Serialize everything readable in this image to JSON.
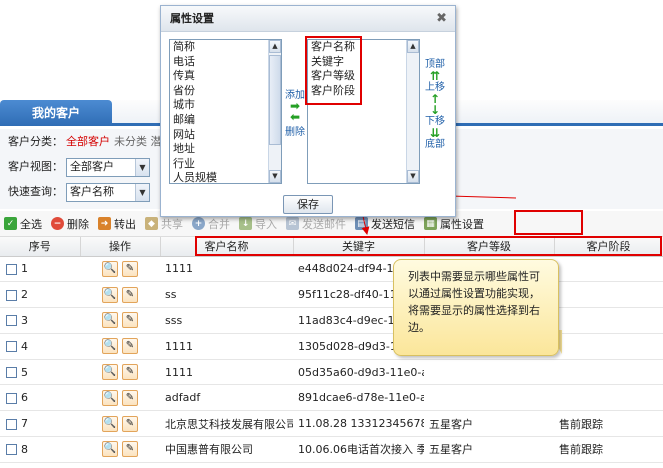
{
  "tab": {
    "label": "我的客户"
  },
  "filters": {
    "category_label": "客户分类：",
    "category_active": "全部客户",
    "category_rest": "未分类 潜",
    "view_label": "客户视图：",
    "view_value": "全部客户",
    "query_label": "快速查询：",
    "query_value": "客户名称"
  },
  "toolbar": {
    "select_all": "全选",
    "delete": "删除",
    "transfer": "转出",
    "share": "共享",
    "merge": "合并",
    "import": "导入",
    "send_mail": "发送邮件",
    "send_sms": "发送短信",
    "attr_settings": "属性设置"
  },
  "table": {
    "headers": [
      "序号",
      "操作",
      "客户名称",
      "关键字",
      "客户等级",
      "客户阶段"
    ],
    "rows": [
      {
        "idx": "1",
        "name": "1111",
        "key": "e448d024-df94-11e0-a...",
        "level": "",
        "stage": ""
      },
      {
        "idx": "2",
        "name": "ss",
        "key": "95f11c28-df40-11e0-a...",
        "level": "",
        "stage": ""
      },
      {
        "idx": "3",
        "name": "sss",
        "key": "11ad83c4-d9ec-11e0-a...",
        "level": "",
        "stage": ""
      },
      {
        "idx": "4",
        "name": "1111",
        "key": "1305d028-d9d3-11e0-a...",
        "level": "",
        "stage": ""
      },
      {
        "idx": "5",
        "name": "1111",
        "key": "05d35a60-d9d3-11e0-a4ff",
        "level": "",
        "stage": ""
      },
      {
        "idx": "6",
        "name": "adfadf",
        "key": "891dcae6-d78e-11e0-a4ff",
        "level": "",
        "stage": ""
      },
      {
        "idx": "7",
        "name": "北京思艾科技发展有限公司",
        "key": "11.08.28 13312345678",
        "level": "五星客户",
        "stage": "售前跟踪"
      },
      {
        "idx": "8",
        "name": "中国惠普有限公司",
        "key": "10.06.06电话首次接入 季诚",
        "level": "五星客户",
        "stage": "售前跟踪"
      }
    ]
  },
  "modal": {
    "title": "属性设置",
    "close_icon": "close-icon",
    "available": [
      "简称",
      "电话",
      "传真",
      "省份",
      "城市",
      "邮编",
      "网站",
      "地址",
      "行业",
      "人员规模",
      "人员..."
    ],
    "selected": [
      "客户名称",
      "关键字",
      "客户等级",
      "客户阶段"
    ],
    "add_label": "添加",
    "remove_label": "删除",
    "top_label": "顶部",
    "up_label": "上移",
    "down_label": "下移",
    "bottom_label": "底部",
    "save_label": "保存"
  },
  "callout": {
    "text": "列表中需要显示哪些属性可以通过属性设置功能实现，将需要显示的属性选择到右边。"
  },
  "colors": {
    "accent": "#2f6db5",
    "highlight": "#e00000",
    "callout": "#fbe69a"
  }
}
